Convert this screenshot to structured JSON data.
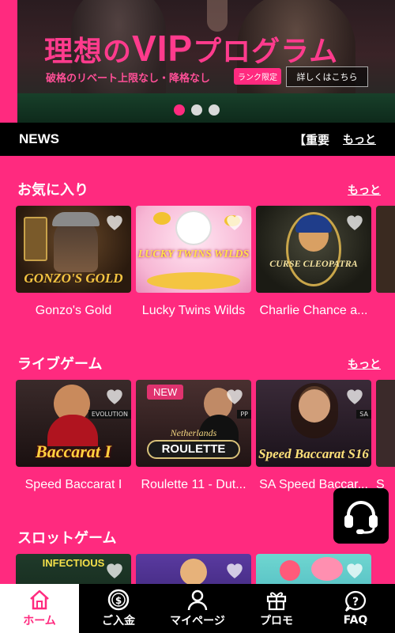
{
  "hero": {
    "title_prefix": "理想の",
    "title_vip": "VIP",
    "title_suffix": "プログラム",
    "subtitle": "破格のリベート上限なし・降格なし",
    "badge": "ランク限定",
    "button": "詳しくはこちら",
    "slide_count": 3,
    "active_slide": 1
  },
  "news": {
    "label": "NEWS",
    "ticker": "【重要",
    "more": "もっと"
  },
  "favorites": {
    "title": "お気に入り",
    "more": "もっと",
    "games": [
      {
        "name": "Gonzo's Gold",
        "art_text": "GONZO'S GOLD"
      },
      {
        "name": "Lucky Twins Wilds",
        "art_text": "LUCKY TWINS WILDS"
      },
      {
        "name": "Charlie Chance a...",
        "art_text": "CURSE CLEOPATRA"
      }
    ]
  },
  "live": {
    "title": "ライブゲーム",
    "more": "もっと",
    "games": [
      {
        "name": "Speed Baccarat I",
        "art_text": "Baccarat I",
        "badge": "EVOLUTION"
      },
      {
        "name": "Roulette 11 - Dut...",
        "art_text": "ROULETTE",
        "art_sub": "Netherlands",
        "badge": "PP",
        "tag": "NEW"
      },
      {
        "name": "SA Speed Baccar...",
        "art_text": "Speed Baccarat S16",
        "badge": "SA"
      }
    ],
    "partial_name": "S"
  },
  "slots": {
    "title": "スロットゲーム",
    "games": [
      {
        "art_text": "INFECTIOUS"
      }
    ]
  },
  "support": {
    "icon": "headset-icon"
  },
  "bottom_nav": [
    {
      "label": "ホーム",
      "icon": "home-icon",
      "active": true
    },
    {
      "label": "ご入金",
      "icon": "dollar-coin-icon",
      "active": false
    },
    {
      "label": "マイページ",
      "icon": "user-icon",
      "active": false
    },
    {
      "label": "プロモ",
      "icon": "gift-icon",
      "active": false
    },
    {
      "label": "FAQ",
      "icon": "question-icon",
      "active": false
    }
  ],
  "colors": {
    "brand_pink": "#ff2a7f",
    "black": "#000000",
    "white": "#ffffff"
  }
}
